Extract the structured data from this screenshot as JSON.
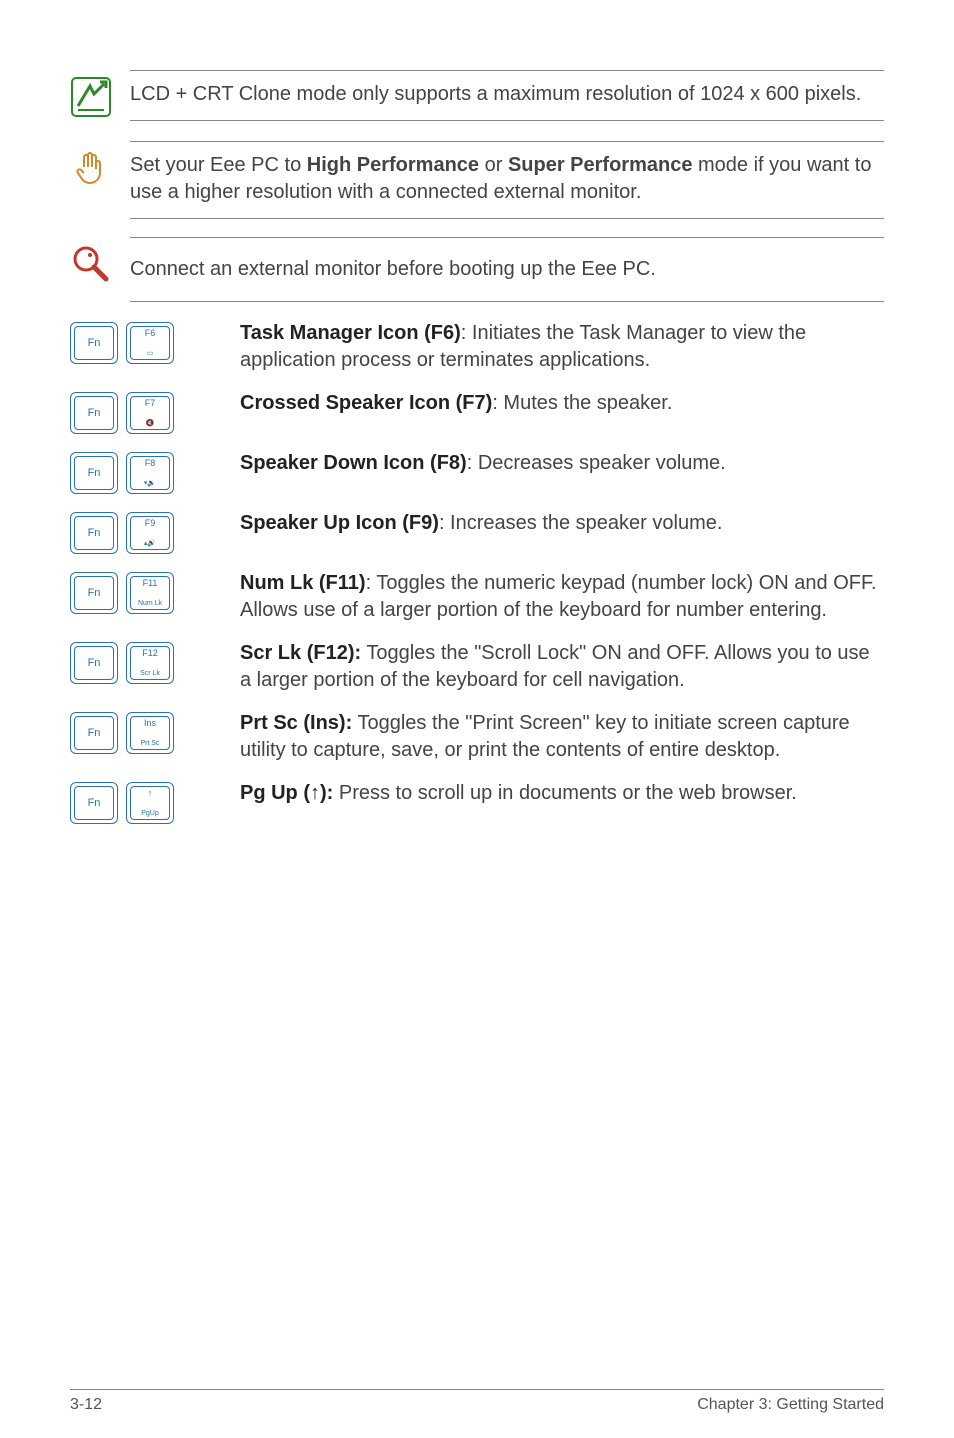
{
  "notes": {
    "lcd": "LCD + CRT Clone mode only supports a maximum resolution of 1024 x 600 pixels.",
    "perf_pre": "Set your Eee PC to ",
    "perf_b1": "High Performance",
    "perf_mid": " or ",
    "perf_b2": "Super Performance",
    "perf_post": " mode if you want to use a higher resolution with a connected external monitor.",
    "ext": "Connect an external monitor before booting up the Eee PC."
  },
  "rows": {
    "f6_lead": "Task Manager Icon (F6)",
    "f6_rest": ": Initiates the Task Manager to view the application process or terminates applications.",
    "f7_lead": "Crossed Speaker Icon (F7)",
    "f7_rest": ": Mutes the speaker.",
    "f8_lead": "Speaker Down Icon (F8)",
    "f8_rest": ": Decreases speaker volume.",
    "f9_lead": "Speaker Up Icon (F9)",
    "f9_rest": ": Increases the speaker volume.",
    "f11_lead": "Num Lk (F11)",
    "f11_rest": ": Toggles the numeric keypad (number lock) ON and OFF. Allows use of a larger portion of the keyboard for number entering.",
    "f12_lead": "Scr Lk (F12):",
    "f12_rest": " Toggles the \"Scroll Lock\" ON and OFF. Allows you to use a larger portion of the keyboard for cell navigation.",
    "ins_lead": "Prt Sc (Ins):",
    "ins_rest": " Toggles the \"Print Screen\" key to initiate screen capture utility to capture, save, or print the contents of entire desktop.",
    "pgup_lead": "Pg Up (↑):",
    "pgup_rest": " Press to scroll up in documents or the web browser."
  },
  "keys": {
    "fn": "Fn",
    "f6": "F6",
    "f7": "F7",
    "f8": "F8",
    "f9": "F9",
    "f11": "F11",
    "f12": "F12",
    "ins": "Ins",
    "numlk": "Num Lk",
    "scrlk": "Scr Lk",
    "prtsc": "Prt Sc",
    "pgup": "PgUp",
    "arrow": "↑"
  },
  "footer": {
    "page": "3-12",
    "chapter": "Chapter 3: Getting Started"
  }
}
